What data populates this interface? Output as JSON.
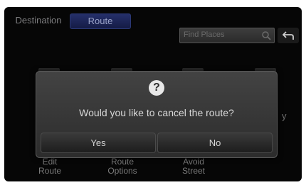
{
  "tabs": {
    "destination": "Destination",
    "route": "Route"
  },
  "search": {
    "placeholder": "Find Places"
  },
  "menu": {
    "items": [
      {
        "line1": "Edit",
        "line2": "Route"
      },
      {
        "line1": "Route",
        "line2": "Options"
      },
      {
        "line1": "Avoid",
        "line2": "Street"
      }
    ],
    "right_partial": "y"
  },
  "dialog": {
    "icon": "?",
    "message": "Would you like to cancel the route?",
    "yes_label": "Yes",
    "no_label": "No"
  },
  "colors": {
    "screen_bg": "#060606",
    "route_tab_bg": "#1f2858",
    "dialog_bg": "#393939"
  }
}
